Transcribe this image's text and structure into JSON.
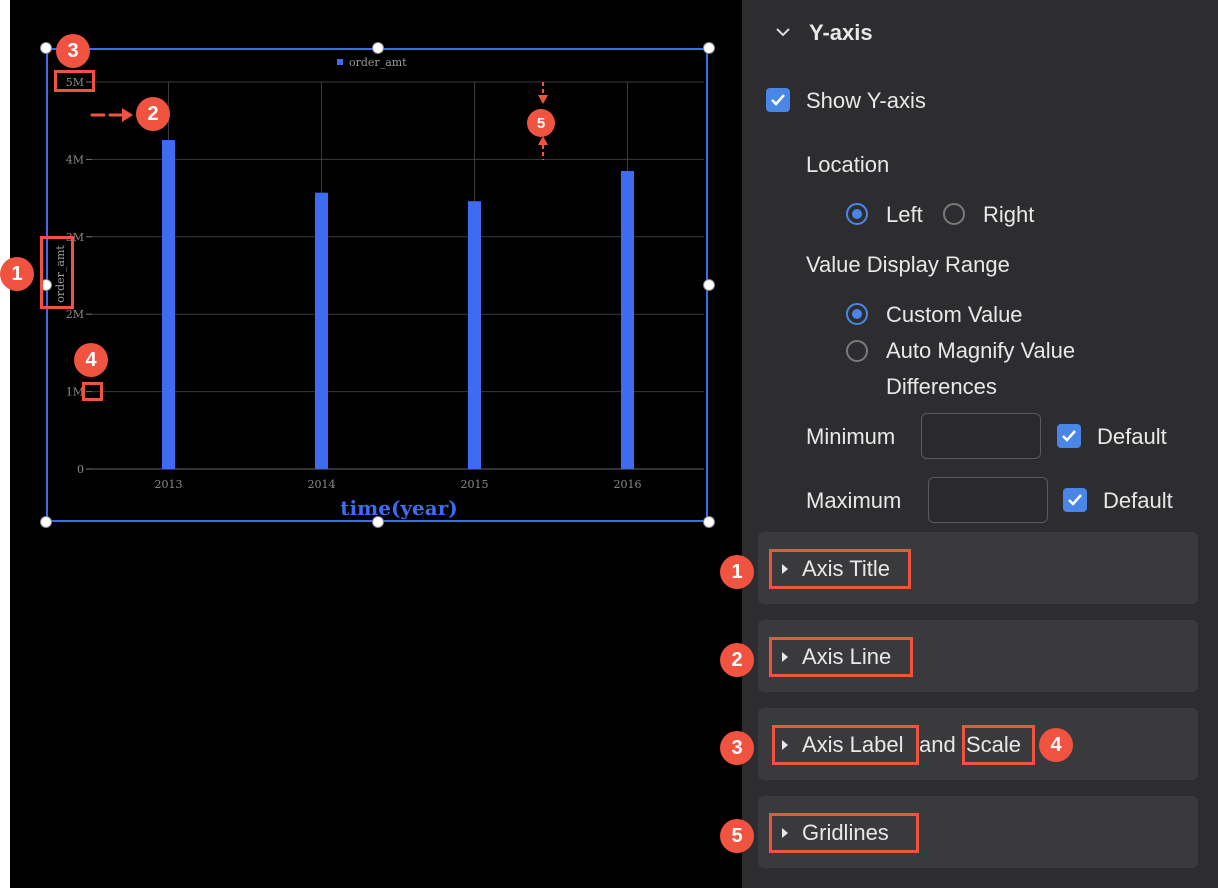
{
  "chart_data": {
    "type": "bar",
    "categories": [
      "2013",
      "2014",
      "2015",
      "2016"
    ],
    "series": [
      {
        "name": "order_amt",
        "values": [
          4250000,
          3570000,
          3460000,
          3850000
        ]
      }
    ],
    "xlabel": "time(year)",
    "ylabel": "order_amt",
    "ylim": [
      0,
      5000000
    ],
    "yticks": [
      {
        "value": 0,
        "label": "0"
      },
      {
        "value": 1000000,
        "label": "1M"
      },
      {
        "value": 2000000,
        "label": "2M"
      },
      {
        "value": 3000000,
        "label": "3M"
      },
      {
        "value": 4000000,
        "label": "4M"
      },
      {
        "value": 5000000,
        "label": "5M"
      }
    ],
    "grid": true,
    "legend": "top-center",
    "bar_color": "#3d6cf0"
  },
  "badges": {
    "b1": "1",
    "b2": "2",
    "b3": "3",
    "b4": "4",
    "b5": "5"
  },
  "panel": {
    "section_title": "Y-axis",
    "show_y_axis_label": "Show Y-axis",
    "location_label": "Location",
    "location_options": [
      "Left",
      "Right"
    ],
    "value_range_label": "Value Display Range",
    "range_custom": "Custom Value",
    "range_auto_line1": "Auto Magnify Value",
    "range_auto_line2": "Differences",
    "minimum_label": "Minimum",
    "maximum_label": "Maximum",
    "default_label": "Default",
    "minimum_value": "",
    "maximum_value": "",
    "sections": {
      "axis_title": "Axis Title",
      "axis_line": "Axis Line",
      "axis_label": "Axis Label",
      "and_word": "and",
      "scale": "Scale",
      "gridlines": "Gridlines"
    }
  },
  "colors": {
    "accent": "#4a86e8",
    "annotation": "#f0533f",
    "panel_bg": "#2d2d2f",
    "section_bg": "#3a3a3c"
  }
}
